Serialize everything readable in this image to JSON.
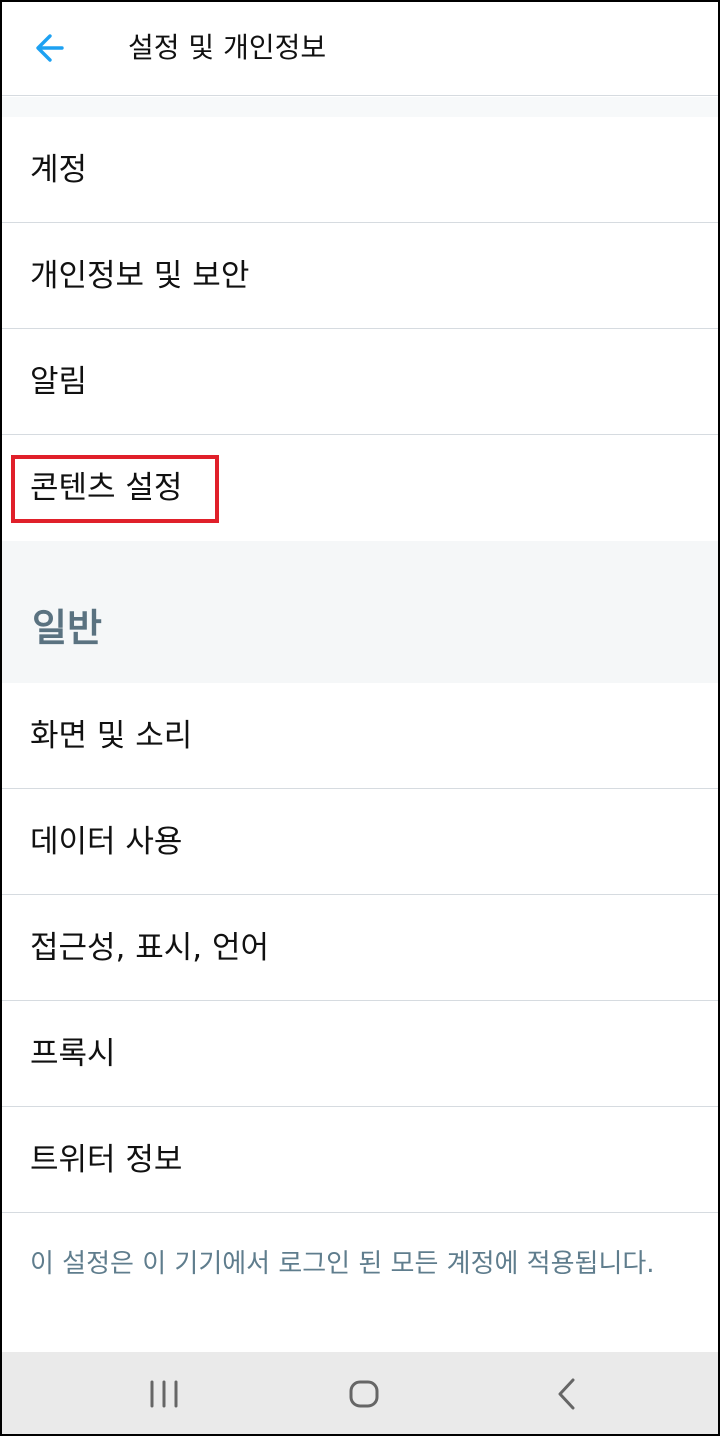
{
  "header": {
    "title": "설정 및 개인정보",
    "back_icon": "arrow-left-icon",
    "accent_color": "#1da1f2"
  },
  "account_items": [
    {
      "label": "계정"
    },
    {
      "label": "개인정보 및 보안"
    },
    {
      "label": "알림"
    },
    {
      "label": "콘텐츠 설정",
      "highlighted": true
    }
  ],
  "general_section": {
    "title": "일반",
    "items": [
      {
        "label": "화면 및 소리"
      },
      {
        "label": "데이터 사용"
      },
      {
        "label": "접근성, 표시, 언어"
      },
      {
        "label": "프록시"
      },
      {
        "label": "트위터 정보"
      }
    ]
  },
  "footer_note": "이 설정은 이 기기에서 로그인 된 모든 계정에 적용됩니다.",
  "nav_bar": {
    "recent_icon": "recent-apps-icon",
    "home_icon": "home-icon",
    "back_icon": "back-chevron-icon"
  }
}
